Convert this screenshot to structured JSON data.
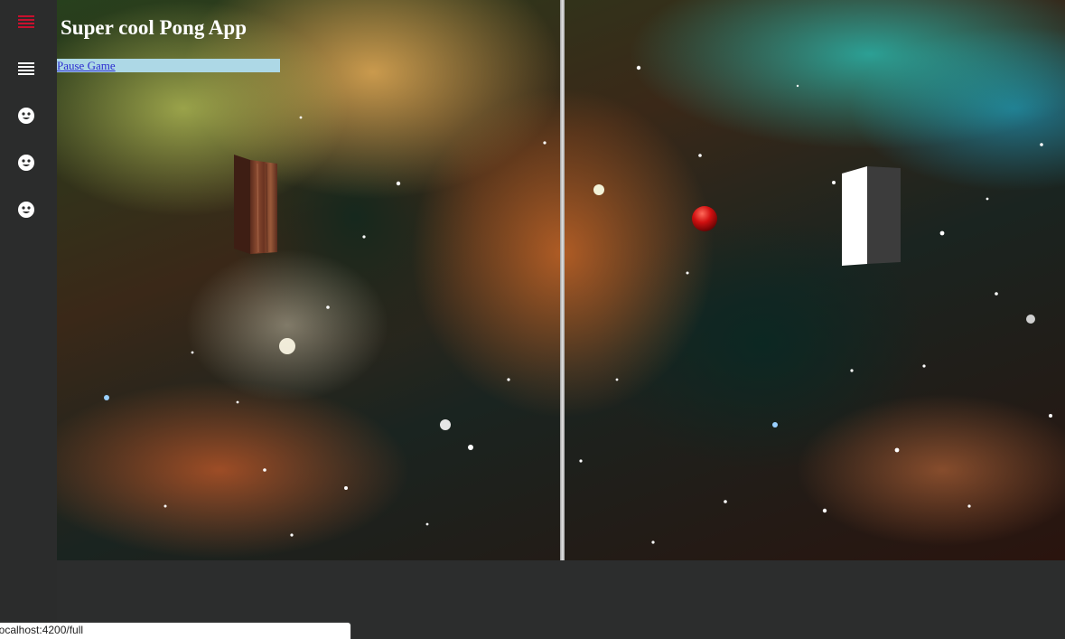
{
  "app": {
    "title": "Super cool Pong App"
  },
  "controls": {
    "pause_label": "Pause Game"
  },
  "sidebar": {
    "items": [
      {
        "icon": "menu-icon",
        "color": "#c8102e",
        "active": true
      },
      {
        "icon": "list-icon",
        "color": "#ffffff",
        "active": false
      },
      {
        "icon": "face-icon",
        "color": "#ffffff",
        "active": false
      },
      {
        "icon": "face-icon",
        "color": "#ffffff",
        "active": false
      },
      {
        "icon": "face-icon",
        "color": "#ffffff",
        "active": false
      }
    ]
  },
  "game": {
    "left_paddle": {
      "texture": "wood"
    },
    "right_paddle": {
      "color": "#ffffff"
    },
    "ball": {
      "color": "#d01010"
    },
    "background": "nebula-space"
  },
  "status_bar": {
    "url": "localhost:4200/full"
  },
  "colors": {
    "sidebar_bg": "#2b2c2c",
    "accent_red": "#c8102e",
    "pause_bg": "#add8e6"
  }
}
